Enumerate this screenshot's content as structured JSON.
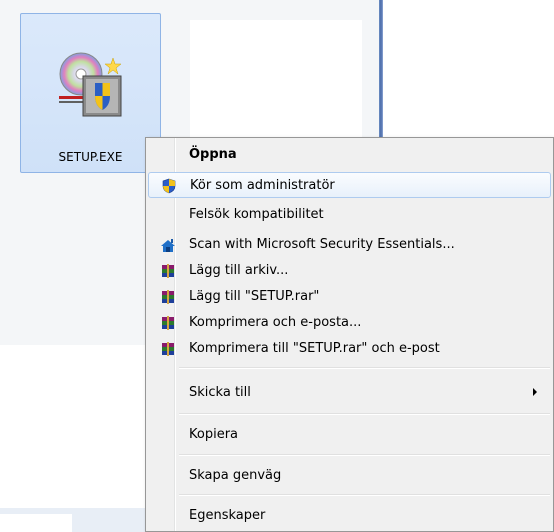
{
  "desktop": {
    "file": {
      "name": "SETUP.EXE",
      "icon": "setup-installer-icon"
    }
  },
  "context_menu": {
    "items": [
      {
        "label": "Öppna",
        "icon": null,
        "bold": true
      },
      {
        "label": "Kör som administratör",
        "icon": "uac-shield-icon",
        "highlighted": true
      },
      {
        "label": "Felsök kompatibilitet",
        "icon": null
      },
      {
        "label": "Scan with Microsoft Security Essentials...",
        "icon": "security-essentials-icon"
      },
      {
        "label": "Lägg till arkiv...",
        "icon": "winrar-icon"
      },
      {
        "label": "Lägg till \"SETUP.rar\"",
        "icon": "winrar-icon"
      },
      {
        "label": "Komprimera och e-posta...",
        "icon": "winrar-icon"
      },
      {
        "label": "Komprimera till \"SETUP.rar\" och e-post",
        "icon": "winrar-icon"
      },
      {
        "label": "Skicka till",
        "icon": null,
        "submenu": true
      },
      {
        "label": "Kopiera",
        "icon": null
      },
      {
        "label": "Skapa genväg",
        "icon": null
      },
      {
        "label": "Egenskaper",
        "icon": null
      }
    ]
  }
}
